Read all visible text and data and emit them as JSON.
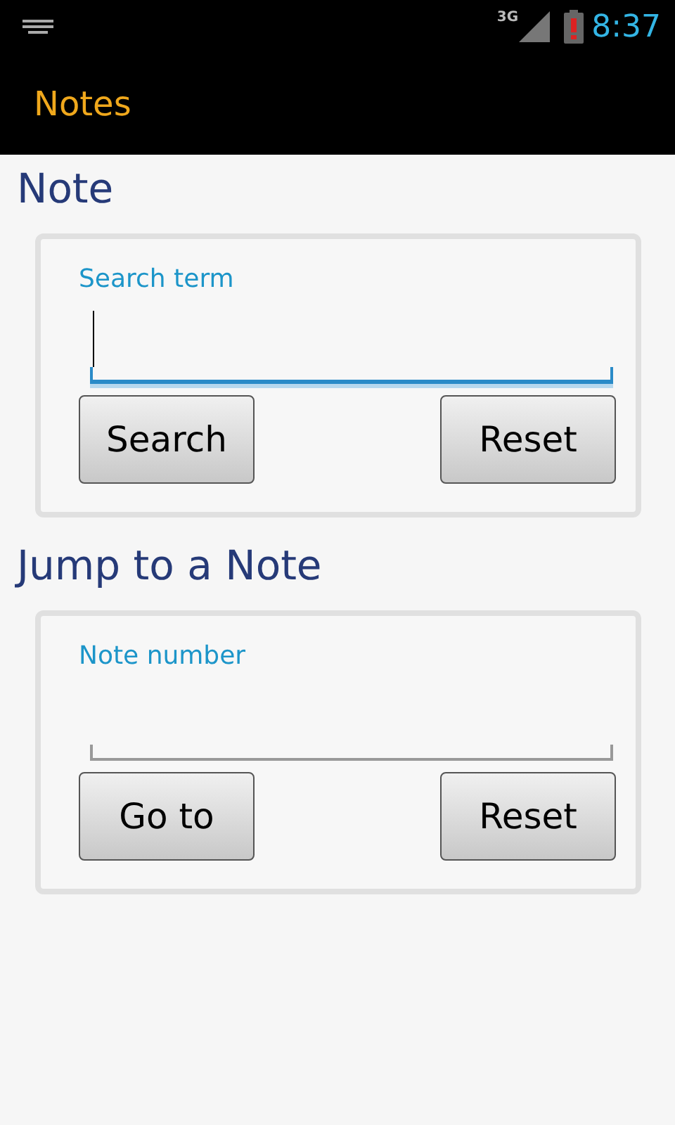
{
  "status_bar": {
    "network": "3G",
    "time": "8:37"
  },
  "action_bar": {
    "title": "Notes"
  },
  "sections": [
    {
      "heading": "Note",
      "field": {
        "label": "Search term",
        "focused": true
      },
      "buttons": [
        "Search",
        "Reset"
      ]
    },
    {
      "heading": "Jump to a Note",
      "field": {
        "label": "Note number",
        "focused": false
      },
      "buttons": [
        "Go to",
        "Reset"
      ]
    }
  ]
}
